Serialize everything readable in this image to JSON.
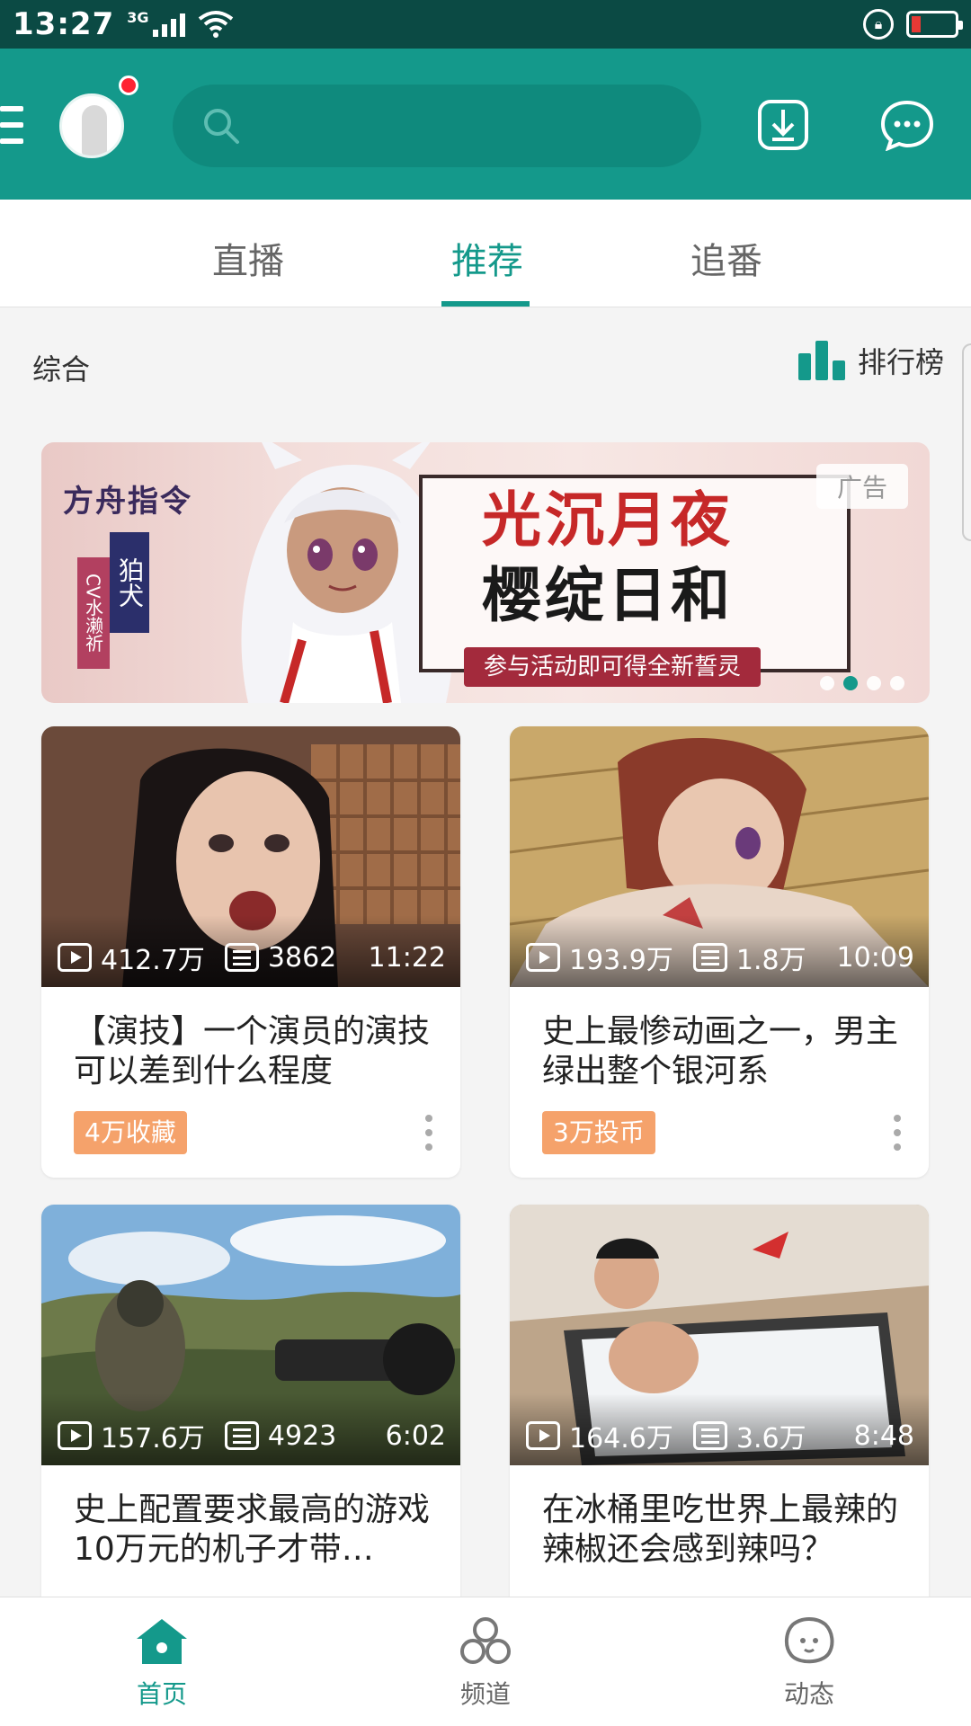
{
  "status_bar": {
    "time": "13:27",
    "network": "3G"
  },
  "search": {
    "placeholder": ""
  },
  "tabs": [
    {
      "label": "直播"
    },
    {
      "label": "推荐"
    },
    {
      "label": "追番"
    }
  ],
  "section": {
    "title": "综合",
    "rank_label": "排行榜"
  },
  "banner": {
    "logo_text": "方舟指令",
    "cv_text": "CV水濑祈",
    "role_text": "狛犬",
    "headline_line1": "光沉月夜",
    "headline_line2": "樱绽日和",
    "subtitle": "参与活动即可得全新誓灵",
    "ad_label": "广告",
    "active_dot": 1,
    "dot_count": 4
  },
  "videos": [
    {
      "views": "412.7万",
      "danmaku": "3862",
      "duration": "11:22",
      "title": "【演技】一个演员的演技可以差到什么程度",
      "tag": "4万收藏"
    },
    {
      "views": "193.9万",
      "danmaku": "1.8万",
      "duration": "10:09",
      "title": "史上最惨动画之一，男主绿出整个银河系",
      "tag": "3万投币"
    },
    {
      "views": "157.6万",
      "danmaku": "4923",
      "duration": "6:02",
      "title": "史上配置要求最高的游戏 10万元的机子才带…",
      "tag": ""
    },
    {
      "views": "164.6万",
      "danmaku": "3.6万",
      "duration": "8:48",
      "title": "在冰桶里吃世界上最辣的辣椒还会感到辣吗？",
      "tag": ""
    }
  ],
  "bottom_nav": [
    {
      "label": "首页",
      "icon": "home-icon"
    },
    {
      "label": "频道",
      "icon": "channel-icon"
    },
    {
      "label": "动态",
      "icon": "feed-icon"
    }
  ],
  "colors": {
    "brand": "#14998b",
    "status_bar": "#0b4a44",
    "tag": "#f5a26b"
  }
}
